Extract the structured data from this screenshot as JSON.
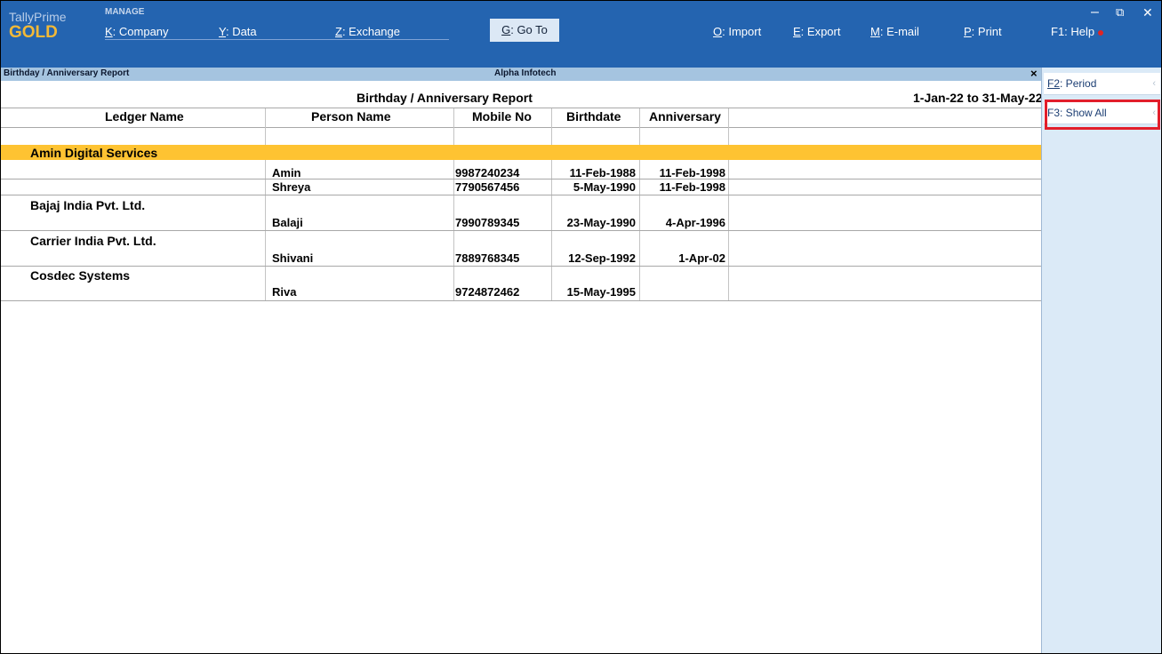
{
  "app": {
    "brand_top": "TallyPrime",
    "brand_edition": "GOLD",
    "manage_label": "MANAGE"
  },
  "menu": {
    "company": {
      "key": "K",
      "label": ": Company"
    },
    "data": {
      "key": "Y",
      "label": ": Data"
    },
    "exchange": {
      "key": "Z",
      "label": ": Exchange"
    },
    "goto": {
      "key": "G",
      "label": ": Go To"
    },
    "import": {
      "key": "O",
      "label": ": Import"
    },
    "export": {
      "key": "E",
      "label": ": Export"
    },
    "email": {
      "key": "M",
      "label": ": E-mail"
    },
    "print": {
      "key": "P",
      "label": ": Print"
    },
    "help": {
      "label": "F1: Help"
    }
  },
  "window_controls": {
    "minimize": "–",
    "restore": "⧉",
    "close": "✕"
  },
  "strip": {
    "report_name": "Birthday / Anniversary Report",
    "company": "Alpha Infotech",
    "close": "×"
  },
  "report": {
    "title": "Birthday / Anniversary Report",
    "period": "1-Jan-22 to 31-May-22",
    "columns": {
      "ledger": "Ledger Name",
      "person": "Person Name",
      "mobile": "Mobile No",
      "birthdate": "Birthdate",
      "anniversary": "Anniversary"
    },
    "groups": [
      {
        "ledger": "Amin Digital Services",
        "rows": [
          {
            "person": "Amin",
            "mobile": "9987240234",
            "birthdate": "11-Feb-1988",
            "anniversary": "11-Feb-1998"
          },
          {
            "person": "Shreya",
            "mobile": "7790567456",
            "birthdate": "5-May-1990",
            "anniversary": "11-Feb-1998"
          }
        ]
      },
      {
        "ledger": "Bajaj India Pvt. Ltd.",
        "rows": [
          {
            "person": "Balaji",
            "mobile": "7990789345",
            "birthdate": "23-May-1990",
            "anniversary": "4-Apr-1996"
          }
        ]
      },
      {
        "ledger": "Carrier India Pvt. Ltd.",
        "rows": [
          {
            "person": "Shivani",
            "mobile": "7889768345",
            "birthdate": "12-Sep-1992",
            "anniversary": "1-Apr-02"
          }
        ]
      },
      {
        "ledger": "Cosdec Systems",
        "rows": [
          {
            "person": "Riva",
            "mobile": "9724872462",
            "birthdate": "15-May-1995",
            "anniversary": ""
          }
        ]
      }
    ]
  },
  "side_panel": {
    "period": {
      "key": "F2",
      "label": ": Period"
    },
    "show_all": {
      "key": "F3",
      "label": ": Show All"
    },
    "chevron": "‹"
  },
  "colors": {
    "topbar": "#2464b0",
    "brand_gold": "#f2b938",
    "title_strip": "#a5c4e0",
    "selected_band": "#fec332",
    "side_panel": "#dbeaf7",
    "highlight": "#e21e2b"
  }
}
